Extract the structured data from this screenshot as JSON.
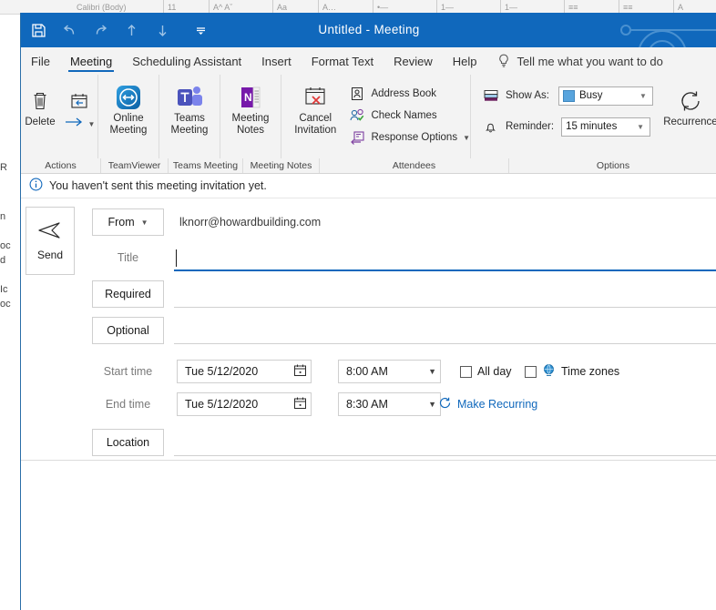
{
  "window": {
    "title": "Untitled  -  Meeting",
    "quick_access": [
      {
        "name": "save-icon",
        "label": "Save",
        "enabled": true
      },
      {
        "name": "undo-icon",
        "label": "Undo",
        "enabled": false
      },
      {
        "name": "redo-icon",
        "label": "Redo",
        "enabled": false
      },
      {
        "name": "previous-item-icon",
        "label": "Previous Item",
        "enabled": false
      },
      {
        "name": "next-item-icon",
        "label": "Next Item",
        "enabled": false
      },
      {
        "name": "customize-quick-access-toolbar-icon",
        "label": "Customize Quick Access Toolbar",
        "enabled": true
      }
    ],
    "accent_color": "#1068bc"
  },
  "tabs": [
    {
      "label": "File",
      "active": false
    },
    {
      "label": "Meeting",
      "active": true
    },
    {
      "label": "Scheduling Assistant",
      "active": false
    },
    {
      "label": "Insert",
      "active": false
    },
    {
      "label": "Format Text",
      "active": false
    },
    {
      "label": "Review",
      "active": false
    },
    {
      "label": "Help",
      "active": false
    }
  ],
  "tell_me": {
    "placeholder": "Tell me what you want to do",
    "icon": "lightbulb-icon"
  },
  "ribbon": {
    "groups": [
      {
        "label": "Actions",
        "items": [
          {
            "label": "Delete",
            "icon": "trash-icon"
          },
          {
            "label": "",
            "icon": "forward-meeting-icon"
          }
        ]
      },
      {
        "label": "TeamViewer",
        "items": [
          {
            "label": "Online\nMeeting",
            "line1": "Online",
            "line2": "Meeting",
            "icon": "teamviewer-icon"
          }
        ]
      },
      {
        "label": "Teams Meeting",
        "items": [
          {
            "line1": "Teams",
            "line2": "Meeting",
            "icon": "teams-icon"
          }
        ]
      },
      {
        "label": "Meeting Notes",
        "items": [
          {
            "line1": "Meeting",
            "line2": "Notes",
            "icon": "onenote-icon"
          }
        ]
      },
      {
        "label": "Attendees",
        "items": [
          {
            "line1": "Cancel",
            "line2": "Invitation",
            "icon": "cancel-invitation-icon"
          },
          {
            "label": "Address Book",
            "icon": "address-book-icon"
          },
          {
            "label": "Check Names",
            "icon": "check-names-icon"
          },
          {
            "label": "Response Options",
            "icon": "response-options-icon",
            "has_dropdown": true
          }
        ]
      },
      {
        "label": "Options",
        "items": [
          {
            "label": "Show As:",
            "icon": "show-as-icon",
            "value": "Busy",
            "swatch": "#58a4dd"
          },
          {
            "label": "Reminder:",
            "icon": "bell-icon",
            "value": "15 minutes"
          },
          {
            "label": "Recurrence",
            "icon": "recurrence-icon"
          }
        ]
      }
    ]
  },
  "infobar": {
    "icon": "info-icon",
    "text": "You haven't sent this meeting invitation yet."
  },
  "form": {
    "send_button": {
      "label": "Send",
      "icon": "send-icon"
    },
    "from": {
      "button_label": "From",
      "caret": "chevron-down-icon",
      "value": "lknorr@howardbuilding.com"
    },
    "title": {
      "label": "Title",
      "value": "",
      "focused": true
    },
    "required": {
      "button_label": "Required",
      "value": ""
    },
    "optional": {
      "button_label": "Optional",
      "value": ""
    },
    "start_time": {
      "label": "Start time",
      "date": "Tue 5/12/2020",
      "time": "8:00 AM"
    },
    "end_time": {
      "label": "End time",
      "date": "Tue 5/12/2020",
      "time": "8:30 AM"
    },
    "all_day": {
      "label": "All day",
      "checked": false
    },
    "time_zones": {
      "label": "Time zones",
      "checked": false,
      "icon": "globe-icon"
    },
    "make_recurring": {
      "label": "Make Recurring",
      "icon": "recurrence-small-icon"
    },
    "location": {
      "button_label": "Location",
      "value": ""
    }
  },
  "background": {
    "left_fragments": [
      "R",
      "n",
      "oc",
      "d",
      "Ic",
      "oc"
    ],
    "word_ribbon_segments": [
      "Calibri (Body)",
      "11",
      "A^  Aˇ",
      "Aa",
      "A…",
      "•—",
      "1—",
      "1—",
      "≡≡",
      "≡≡",
      "A",
      "¶"
    ]
  }
}
